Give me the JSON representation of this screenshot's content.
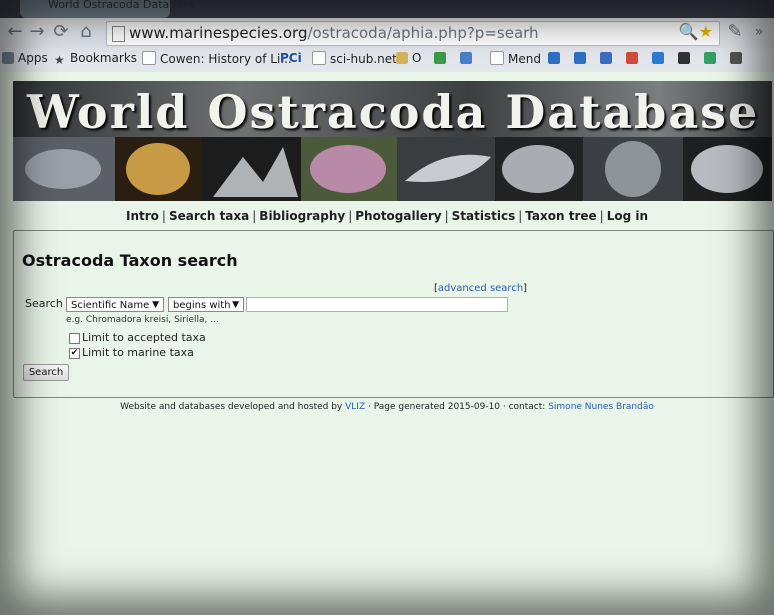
{
  "browser": {
    "tab_title": "World Ostracoda Database",
    "url_host": "www.marinespecies.org",
    "url_path": "/ostracoda/aphia.php?p=searh",
    "bookmarks": [
      "Apps",
      "Bookmarks",
      "Cowen: History of Li...",
      "PCi",
      "sci-hub.net",
      "O",
      "Mend"
    ]
  },
  "banner": {
    "title": "World Ostracoda Database"
  },
  "nav": [
    "Intro",
    "Search taxa",
    "Bibliography",
    "Photogallery",
    "Statistics",
    "Taxon tree",
    "Log in"
  ],
  "search": {
    "heading": "Ostracoda Taxon search",
    "advanced_link": "advanced search",
    "label": "Search",
    "field_select": "Scientific Name",
    "mode_select": "begins with",
    "query_value": "",
    "example": "e.g. Chromadora kreisi, Siriella, ...",
    "limit_accepted_label": "Limit to accepted taxa",
    "limit_accepted_checked": false,
    "limit_marine_label": "Limit to marine taxa",
    "limit_marine_checked": true,
    "button": "Search"
  },
  "footer": {
    "prefix": "Website and databases developed and hosted by",
    "vliz": "VLIZ",
    "middle": "· Page generated 2015-09-10 · contact:",
    "contact": "Simone Nunes Brandão"
  },
  "colors": {
    "link": "#2a5db0",
    "page_bg": "#e9f5e8"
  }
}
